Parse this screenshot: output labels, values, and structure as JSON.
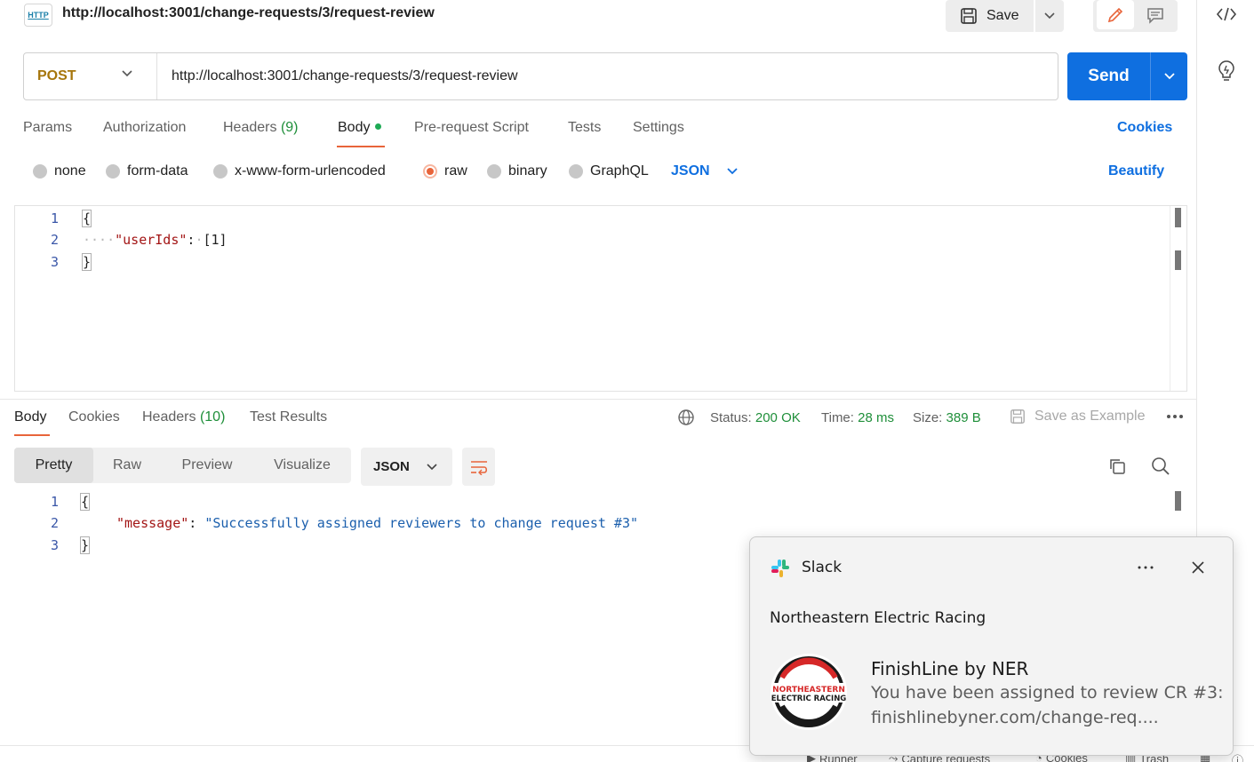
{
  "request": {
    "badge": "HTTP",
    "title": "http://localhost:3001/change-requests/3/request-review",
    "save_label": "Save",
    "method": "POST",
    "url": "http://localhost:3001/change-requests/3/request-review",
    "send_label": "Send"
  },
  "request_tabs": {
    "params": "Params",
    "authorization": "Authorization",
    "headers": "Headers",
    "headers_count": "(9)",
    "body": "Body",
    "pre_request": "Pre-request Script",
    "tests": "Tests",
    "settings": "Settings",
    "cookies": "Cookies"
  },
  "body_types": {
    "none": "none",
    "form_data": "form-data",
    "urlencoded": "x-www-form-urlencoded",
    "raw": "raw",
    "binary": "binary",
    "graphql": "GraphQL",
    "format": "JSON",
    "beautify": "Beautify"
  },
  "request_body": {
    "line_numbers": [
      "1",
      "2",
      "3"
    ],
    "open": "{",
    "indent": "····",
    "key": "\"userIds\"",
    "colon": ":",
    "sep": "·",
    "value": "[1]",
    "close": "}"
  },
  "response_tabs": {
    "body": "Body",
    "cookies": "Cookies",
    "headers": "Headers",
    "headers_count": "(10)",
    "test_results": "Test Results"
  },
  "response_meta": {
    "status_label": "Status:",
    "status_value": "200 OK",
    "time_label": "Time:",
    "time_value": "28 ms",
    "size_label": "Size:",
    "size_value": "389 B",
    "save_example": "Save as Example"
  },
  "response_view": {
    "pretty": "Pretty",
    "raw": "Raw",
    "preview": "Preview",
    "visualize": "Visualize",
    "format": "JSON"
  },
  "response_body": {
    "line_numbers": [
      "1",
      "2",
      "3"
    ],
    "open": "{",
    "key": "\"message\"",
    "colon": ":",
    "value": "\"Successfully assigned reviewers to change request #3\"",
    "close": "}"
  },
  "bottom_bar": {
    "runner": "Runner",
    "capture": "Capture requests",
    "cookies": "Cookies",
    "trash": "Trash"
  },
  "notification": {
    "app": "Slack",
    "workspace": "Northeastern Electric Racing",
    "sender": "FinishLine by NER",
    "message_line1": "You have been assigned to review CR #3:",
    "message_line2": "finishlinebyner.com/change-req....",
    "logo_line1": "NORTHEASTERN",
    "logo_line2": "ELECTRIC RACING"
  },
  "colors": {
    "accent_blue": "#0f6fe0",
    "accent_orange": "#e8643a",
    "status_green": "#1f8f3a",
    "method_post": "#a6760c"
  }
}
